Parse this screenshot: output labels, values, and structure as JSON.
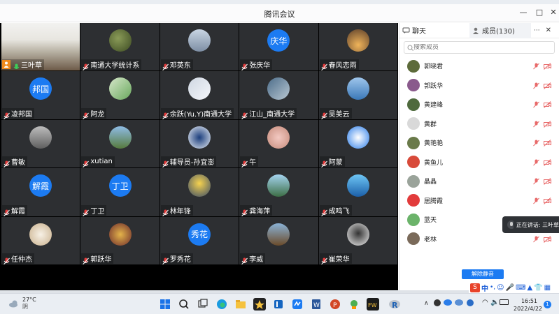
{
  "window": {
    "title": "腾讯会议"
  },
  "participants": [
    {
      "name": "三叶草",
      "avatar_text": "",
      "host": true
    },
    {
      "name": "南通大学统计系",
      "avatar_text": ""
    },
    {
      "name": "邓英东",
      "avatar_text": ""
    },
    {
      "name": "张庆华",
      "avatar_text": "庆华"
    },
    {
      "name": "春风恋雨",
      "avatar_text": ""
    },
    {
      "name": "凌邦国",
      "avatar_text": "邦国"
    },
    {
      "name": "阿龙",
      "avatar_text": ""
    },
    {
      "name": "余跃(Yu.Y)南通大学",
      "avatar_text": ""
    },
    {
      "name": "江山_南通大学",
      "avatar_text": ""
    },
    {
      "name": "吴美云",
      "avatar_text": ""
    },
    {
      "name": "曹敏",
      "avatar_text": ""
    },
    {
      "name": "xutian",
      "avatar_text": ""
    },
    {
      "name": "辅导员-孙宜澎",
      "avatar_text": ""
    },
    {
      "name": "午",
      "avatar_text": ""
    },
    {
      "name": "阿蒙",
      "avatar_text": ""
    },
    {
      "name": "解霞",
      "avatar_text": "解霞"
    },
    {
      "name": "丁卫",
      "avatar_text": "丁卫"
    },
    {
      "name": "林年锋",
      "avatar_text": ""
    },
    {
      "name": "龚海萍",
      "avatar_text": ""
    },
    {
      "name": "成鸣飞",
      "avatar_text": ""
    },
    {
      "name": "任仲杰",
      "avatar_text": ""
    },
    {
      "name": "郭跃华",
      "avatar_text": ""
    },
    {
      "name": "罗秀花",
      "avatar_text": "秀花"
    },
    {
      "name": "李威",
      "avatar_text": ""
    },
    {
      "name": "崔荣华",
      "avatar_text": ""
    }
  ],
  "side": {
    "chat_tab": "聊天",
    "members_tab": "成员(130)",
    "more": "···",
    "search_placeholder": "搜索成员",
    "members": [
      "郭晓君",
      "郭跃华",
      "黄建峰",
      "黄群",
      "黄艳艳",
      "黄鱼儿",
      "晶晶",
      "居腾霞",
      "蓝天",
      "老林"
    ],
    "unmute_all": "解除静音"
  },
  "speaking": {
    "text": "正在讲话: 三叶草"
  },
  "taskbar": {
    "temp": "27°C",
    "condition": "阴",
    "time": "16:51",
    "date": "2022/4/22",
    "notifications": "1",
    "ime_lang": "中"
  },
  "colors": {
    "accent": "#1c7bf2",
    "tile_bg": "#2d2f32",
    "host_badge": "#f08a1c"
  }
}
